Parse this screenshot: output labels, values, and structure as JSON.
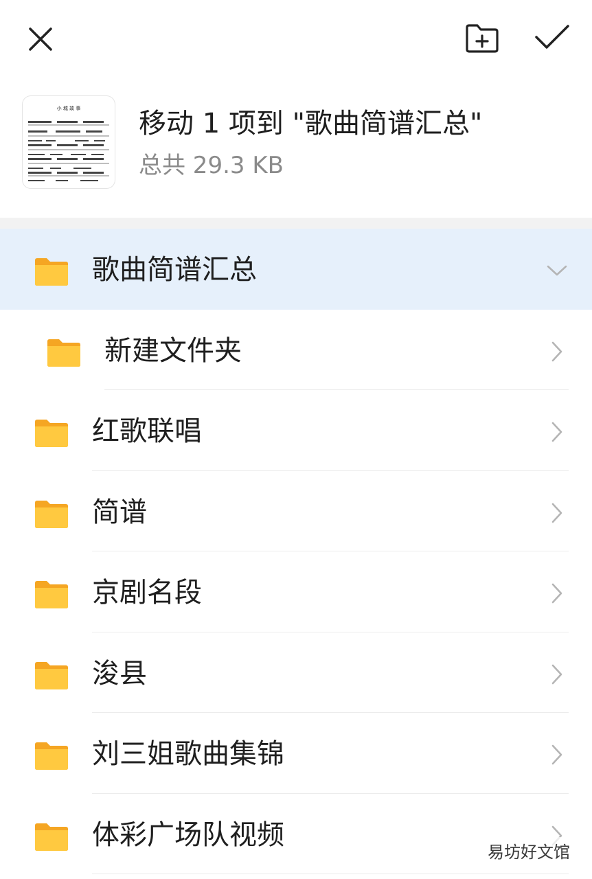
{
  "topbar": {
    "close_icon": "close-icon",
    "new_folder_icon": "folder-plus-icon",
    "confirm_icon": "check-icon"
  },
  "header": {
    "title": "移动 1 项到 \"歌曲简谱汇总\"",
    "subtitle": "总共 29.3 KB",
    "thumbnail": {
      "title": "小 城 故 事"
    }
  },
  "folders": [
    {
      "label": "歌曲简谱汇总",
      "selected": true,
      "expanded": true
    },
    {
      "label": "新建文件夹",
      "child": true
    },
    {
      "label": "红歌联唱"
    },
    {
      "label": "简谱"
    },
    {
      "label": "京剧名段"
    },
    {
      "label": "浚县"
    },
    {
      "label": "刘三姐歌曲集锦"
    },
    {
      "label": "体彩广场队视频"
    }
  ],
  "watermark": "易坊好文馆",
  "colors": {
    "folder": "#FFC940",
    "folder_tab": "#F5A623",
    "selected_bg": "#E6F0FB",
    "chevron": "#B5B5B5"
  }
}
